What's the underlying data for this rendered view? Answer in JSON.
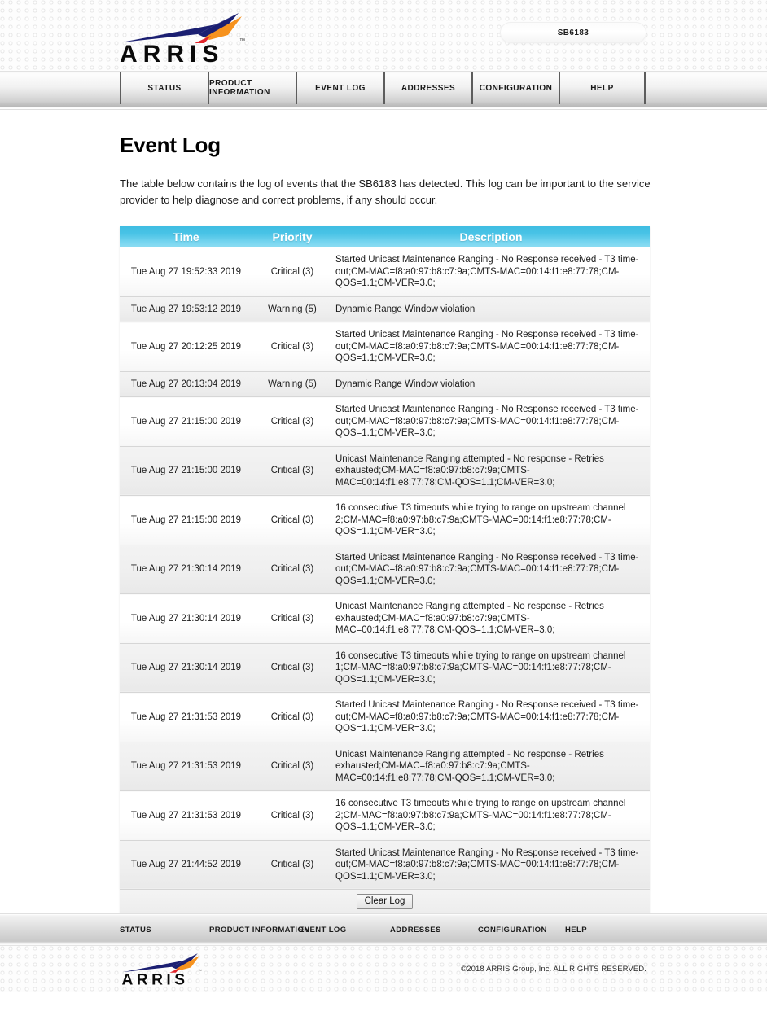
{
  "header": {
    "brand": "ARRIS",
    "model_badge": "SB6183"
  },
  "nav": {
    "items": [
      {
        "label": "STATUS"
      },
      {
        "label": "PRODUCT INFORMATION"
      },
      {
        "label": "EVENT LOG"
      },
      {
        "label": "ADDRESSES"
      },
      {
        "label": "CONFIGURATION"
      },
      {
        "label": "HELP"
      }
    ]
  },
  "main": {
    "title": "Event Log",
    "description": "The table below contains the log of events that the SB6183 has detected. This log can be important to the service provider to help diagnose and correct problems, if any should occur.",
    "table": {
      "columns": [
        "Time",
        "Priority",
        "Description"
      ],
      "rows": [
        {
          "time": "Tue Aug 27 19:52:33 2019",
          "priority": "Critical (3)",
          "description": "Started Unicast Maintenance Ranging - No Response received - T3 time-out;CM-MAC=f8:a0:97:b8:c7:9a;CMTS-MAC=00:14:f1:e8:77:78;CM-QOS=1.1;CM-VER=3.0;"
        },
        {
          "time": "Tue Aug 27 19:53:12 2019",
          "priority": "Warning (5)",
          "description": "Dynamic Range Window violation"
        },
        {
          "time": "Tue Aug 27 20:12:25 2019",
          "priority": "Critical (3)",
          "description": "Started Unicast Maintenance Ranging - No Response received - T3 time-out;CM-MAC=f8:a0:97:b8:c7:9a;CMTS-MAC=00:14:f1:e8:77:78;CM-QOS=1.1;CM-VER=3.0;"
        },
        {
          "time": "Tue Aug 27 20:13:04 2019",
          "priority": "Warning (5)",
          "description": "Dynamic Range Window violation"
        },
        {
          "time": "Tue Aug 27 21:15:00 2019",
          "priority": "Critical (3)",
          "description": "Started Unicast Maintenance Ranging - No Response received - T3 time-out;CM-MAC=f8:a0:97:b8:c7:9a;CMTS-MAC=00:14:f1:e8:77:78;CM-QOS=1.1;CM-VER=3.0;"
        },
        {
          "time": "Tue Aug 27 21:15:00 2019",
          "priority": "Critical (3)",
          "description": "Unicast Maintenance Ranging attempted - No response - Retries exhausted;CM-MAC=f8:a0:97:b8:c7:9a;CMTS-MAC=00:14:f1:e8:77:78;CM-QOS=1.1;CM-VER=3.0;"
        },
        {
          "time": "Tue Aug 27 21:15:00 2019",
          "priority": "Critical (3)",
          "description": "16 consecutive T3 timeouts while trying to range on upstream channel 2;CM-MAC=f8:a0:97:b8:c7:9a;CMTS-MAC=00:14:f1:e8:77:78;CM-QOS=1.1;CM-VER=3.0;"
        },
        {
          "time": "Tue Aug 27 21:30:14 2019",
          "priority": "Critical (3)",
          "description": "Started Unicast Maintenance Ranging - No Response received - T3 time-out;CM-MAC=f8:a0:97:b8:c7:9a;CMTS-MAC=00:14:f1:e8:77:78;CM-QOS=1.1;CM-VER=3.0;"
        },
        {
          "time": "Tue Aug 27 21:30:14 2019",
          "priority": "Critical (3)",
          "description": "Unicast Maintenance Ranging attempted - No response - Retries exhausted;CM-MAC=f8:a0:97:b8:c7:9a;CMTS-MAC=00:14:f1:e8:77:78;CM-QOS=1.1;CM-VER=3.0;"
        },
        {
          "time": "Tue Aug 27 21:30:14 2019",
          "priority": "Critical (3)",
          "description": "16 consecutive T3 timeouts while trying to range on upstream channel 1;CM-MAC=f8:a0:97:b8:c7:9a;CMTS-MAC=00:14:f1:e8:77:78;CM-QOS=1.1;CM-VER=3.0;"
        },
        {
          "time": "Tue Aug 27 21:31:53 2019",
          "priority": "Critical (3)",
          "description": "Started Unicast Maintenance Ranging - No Response received - T3 time-out;CM-MAC=f8:a0:97:b8:c7:9a;CMTS-MAC=00:14:f1:e8:77:78;CM-QOS=1.1;CM-VER=3.0;"
        },
        {
          "time": "Tue Aug 27 21:31:53 2019",
          "priority": "Critical (3)",
          "description": "Unicast Maintenance Ranging attempted - No response - Retries exhausted;CM-MAC=f8:a0:97:b8:c7:9a;CMTS-MAC=00:14:f1:e8:77:78;CM-QOS=1.1;CM-VER=3.0;"
        },
        {
          "time": "Tue Aug 27 21:31:53 2019",
          "priority": "Critical (3)",
          "description": "16 consecutive T3 timeouts while trying to range on upstream channel 2;CM-MAC=f8:a0:97:b8:c7:9a;CMTS-MAC=00:14:f1:e8:77:78;CM-QOS=1.1;CM-VER=3.0;"
        },
        {
          "time": "Tue Aug 27 21:44:52 2019",
          "priority": "Critical (3)",
          "description": "Started Unicast Maintenance Ranging - No Response received - T3 time-out;CM-MAC=f8:a0:97:b8:c7:9a;CMTS-MAC=00:14:f1:e8:77:78;CM-QOS=1.1;CM-VER=3.0;"
        }
      ]
    },
    "clear_log_label": "Clear Log"
  },
  "footer": {
    "nav_items": [
      {
        "label": "STATUS"
      },
      {
        "label": "PRODUCT INFORMATION"
      },
      {
        "label": "EVENT LOG"
      },
      {
        "label": "ADDRESSES"
      },
      {
        "label": "CONFIGURATION"
      },
      {
        "label": "HELP"
      }
    ],
    "brand": "ARRIS",
    "copyright": "©2018 ARRIS Group, Inc. ALL RIGHTS RESERVED."
  },
  "colors": {
    "table_header_cyan": "#49c3e6",
    "nav_divider": "#5d5d5d",
    "logo_blue": "#1b1f72",
    "logo_orange": "#f6921e",
    "logo_red": "#e1252b"
  }
}
